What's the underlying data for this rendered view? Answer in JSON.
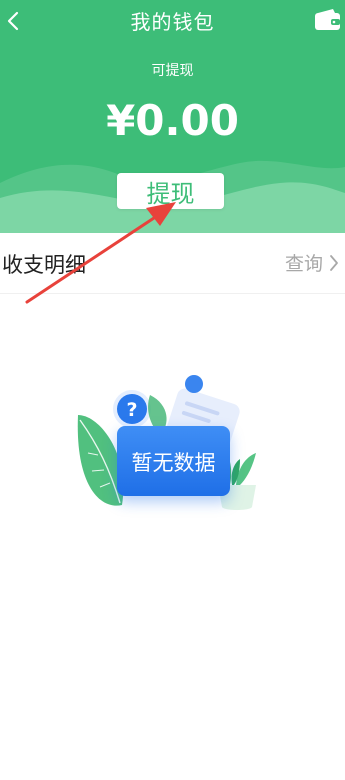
{
  "header": {
    "title": "我的钱包",
    "withdrawable_label": "可提现",
    "balance": "¥0.00",
    "withdraw_label": "提现"
  },
  "details": {
    "title": "收支明细",
    "query_label": "查询"
  },
  "empty_state": {
    "text": "暂无数据"
  },
  "colors": {
    "primary_green": "#3dbd78",
    "empty_blue": "#1f6fe7",
    "annotation_red": "#e8423b"
  }
}
